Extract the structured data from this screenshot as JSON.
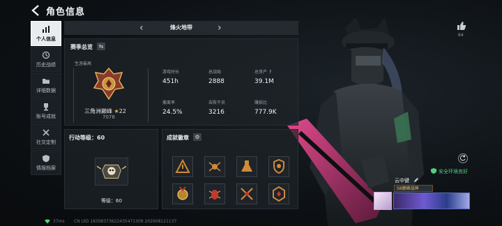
{
  "header": {
    "title": "角色信息"
  },
  "sidebar": {
    "items": [
      {
        "label": "个人信息",
        "icon": "bar-chart-icon",
        "active": true
      },
      {
        "label": "历史战绩",
        "icon": "history-icon",
        "active": false
      },
      {
        "label": "详细数据",
        "icon": "folder-icon",
        "active": false
      },
      {
        "label": "账号成就",
        "icon": "trophy-icon",
        "active": false
      },
      {
        "label": "社交定制",
        "icon": "tools-icon",
        "active": false
      },
      {
        "label": "情报档案",
        "icon": "shield-icon",
        "active": false
      }
    ]
  },
  "mode": {
    "name": "烽火地带"
  },
  "season": {
    "title": "赛季总览",
    "career_label": "生涯最高",
    "rank_name": "三角洲巅峰",
    "rank_stars": "22",
    "rank_score": "7078",
    "stats": [
      {
        "label": "游戏时长",
        "value": "451h"
      },
      {
        "label": "总战局",
        "value": "2888"
      },
      {
        "label": "总资产",
        "value": "39.1M",
        "help": "?"
      },
      {
        "label": "撤离率",
        "value": "24.5%"
      },
      {
        "label": "击败干员",
        "value": "3216"
      },
      {
        "label": "赚损比",
        "value": "777.9K"
      }
    ]
  },
  "level": {
    "title": "行动等级：60",
    "label": "等级：60"
  },
  "achievements": {
    "title": "成就徽章",
    "items": [
      {
        "icon": "warning-badge-icon",
        "color": "#d08a3a"
      },
      {
        "icon": "spider-badge-icon",
        "color": "#d08a3a"
      },
      {
        "icon": "flask-badge-icon",
        "color": "#d08a3a"
      },
      {
        "icon": "shield-badge-icon",
        "color": "#d08a3a"
      },
      {
        "icon": "medal-badge-icon",
        "color": "#d08a3a"
      },
      {
        "icon": "bug-badge-icon",
        "color": "#d08a3a"
      },
      {
        "icon": "crossed-swords-badge-icon",
        "color": "#d08a3a"
      },
      {
        "icon": "hexagon-badge-icon",
        "color": "#d08a3a"
      }
    ]
  },
  "right": {
    "like_count": "64",
    "safe_text": "安全环境良好",
    "player_name": "云中键",
    "player_rank_tag": "S8巅峰战神"
  },
  "status": {
    "ping": "37ms",
    "uid": "CN UID 1839837362243547130​9 202608121137"
  },
  "colors": {
    "accent": "#e6b84a",
    "safe": "#4fd37e",
    "active_tab_bg": "#e9ecee"
  }
}
